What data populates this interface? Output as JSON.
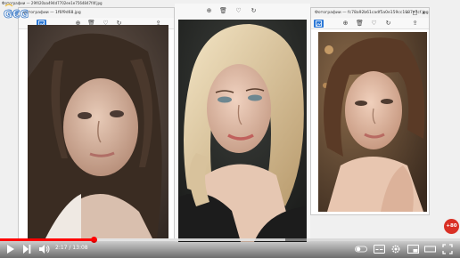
{
  "window_left": {
    "title": "Фотографии — 29f420aa494d7702ee1e7564847f4f.jpg",
    "subtitle": "Фотографии — 1f6f9d68.jpg"
  },
  "window_middle": {
    "title": ""
  },
  "window_right": {
    "title": "Фотографии — fc78a92b61cadf5a0e159cc1987e7cf.jpg"
  },
  "channel": {
    "logo_text": "G€G"
  },
  "player": {
    "time": "2:17 / 13:08",
    "progress_fraction": 0.205,
    "buffer_fraction": 0.62,
    "badge_text": "+80"
  },
  "colors": {
    "accent": "#2b78d6",
    "progress": "#ff0000",
    "badge": "#d93025"
  }
}
